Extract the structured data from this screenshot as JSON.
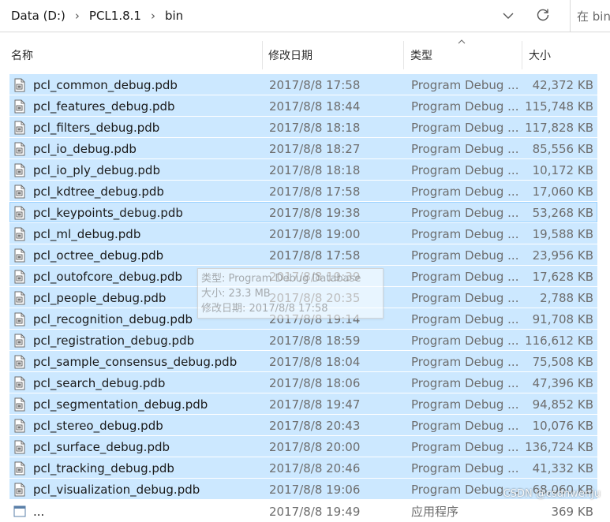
{
  "address": {
    "crumbs": [
      "Data (D:)",
      "PCL1.8.1",
      "bin"
    ],
    "search_placeholder": "在 bin"
  },
  "columns": {
    "name": "名称",
    "date": "修改日期",
    "type": "类型",
    "size": "大小"
  },
  "files": [
    {
      "name": "pcl_common_debug.pdb",
      "date": "2017/8/8 17:58",
      "type": "Program Debug ...",
      "size": "42,372 KB"
    },
    {
      "name": "pcl_features_debug.pdb",
      "date": "2017/8/8 18:44",
      "type": "Program Debug ...",
      "size": "115,748 KB"
    },
    {
      "name": "pcl_filters_debug.pdb",
      "date": "2017/8/8 18:18",
      "type": "Program Debug ...",
      "size": "117,828 KB"
    },
    {
      "name": "pcl_io_debug.pdb",
      "date": "2017/8/8 18:27",
      "type": "Program Debug ...",
      "size": "85,556 KB"
    },
    {
      "name": "pcl_io_ply_debug.pdb",
      "date": "2017/8/8 18:18",
      "type": "Program Debug ...",
      "size": "10,172 KB"
    },
    {
      "name": "pcl_kdtree_debug.pdb",
      "date": "2017/8/8 17:58",
      "type": "Program Debug ...",
      "size": "17,060 KB"
    },
    {
      "name": "pcl_keypoints_debug.pdb",
      "date": "2017/8/8 19:38",
      "type": "Program Debug ...",
      "size": "53,268 KB"
    },
    {
      "name": "pcl_ml_debug.pdb",
      "date": "2017/8/8 19:00",
      "type": "Program Debug ...",
      "size": "19,588 KB"
    },
    {
      "name": "pcl_octree_debug.pdb",
      "date": "2017/8/8 17:58",
      "type": "Program Debug ...",
      "size": "23,956 KB"
    },
    {
      "name": "pcl_outofcore_debug.pdb",
      "date": "2017/8/8 19:39",
      "type": "Program Debug ...",
      "size": "17,628 KB"
    },
    {
      "name": "pcl_people_debug.pdb",
      "date": "2017/8/8 20:35",
      "type": "Program Debug ...",
      "size": "2,788 KB"
    },
    {
      "name": "pcl_recognition_debug.pdb",
      "date": "2017/8/8 19:14",
      "type": "Program Debug ...",
      "size": "91,708 KB"
    },
    {
      "name": "pcl_registration_debug.pdb",
      "date": "2017/8/8 18:59",
      "type": "Program Debug ...",
      "size": "116,612 KB"
    },
    {
      "name": "pcl_sample_consensus_debug.pdb",
      "date": "2017/8/8 18:04",
      "type": "Program Debug ...",
      "size": "75,508 KB"
    },
    {
      "name": "pcl_search_debug.pdb",
      "date": "2017/8/8 18:06",
      "type": "Program Debug ...",
      "size": "47,396 KB"
    },
    {
      "name": "pcl_segmentation_debug.pdb",
      "date": "2017/8/8 19:47",
      "type": "Program Debug ...",
      "size": "94,852 KB"
    },
    {
      "name": "pcl_stereo_debug.pdb",
      "date": "2017/8/8 20:43",
      "type": "Program Debug ...",
      "size": "10,076 KB"
    },
    {
      "name": "pcl_surface_debug.pdb",
      "date": "2017/8/8 20:00",
      "type": "Program Debug ...",
      "size": "136,724 KB"
    },
    {
      "name": "pcl_tracking_debug.pdb",
      "date": "2017/8/8 20:46",
      "type": "Program Debug ...",
      "size": "41,332 KB"
    },
    {
      "name": "pcl_visualization_debug.pdb",
      "date": "2017/8/8 19:06",
      "type": "Program Debug ...",
      "size": "68,060 KB"
    }
  ],
  "partial_row": {
    "name": "...",
    "date": "2017/8/8 19:49",
    "type": "应用程序",
    "size": "369 KB"
  },
  "tooltip": {
    "line1": "类型: Program Debug Database",
    "line2": "大小: 23.3 MB",
    "line3": "修改日期: 2017/8/8 17:58"
  },
  "watermark": "CSDN @csdnwenju",
  "colors": {
    "selection": "#cce8ff",
    "focus_border": "#99d1ff"
  },
  "icons": {
    "file": "pdb-file-icon",
    "dropdown": "chevron-down-icon",
    "refresh": "refresh-icon",
    "sort": "sort-up-icon"
  }
}
